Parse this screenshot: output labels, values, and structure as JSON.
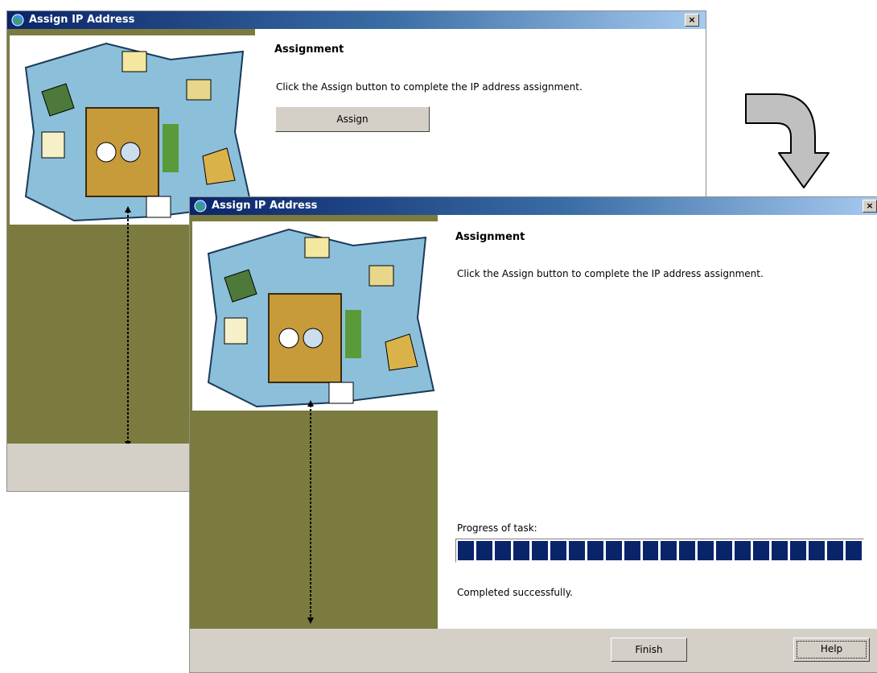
{
  "back_window": {
    "title": "Assign IP Address",
    "heading": "Assignment",
    "description": "Click the Assign button to complete the IP address assignment.",
    "assign_button_label": "Assign",
    "close_label": "×"
  },
  "front_window": {
    "title": "Assign IP Address",
    "heading": "Assignment",
    "description": "Click the Assign button to complete the IP address assignment.",
    "progress_label": "Progress of task:",
    "progress_fraction": 1.0,
    "status_text": "Completed successfully.",
    "finish_button_label": "Finish",
    "help_button_label": "Help",
    "close_label": "×"
  },
  "colors": {
    "titlebar_start": "#0a246a",
    "titlebar_end": "#a6caf0",
    "side_panel": "#7b7b40",
    "progress_fill": "#0a246a",
    "button_face": "#d4d0c8"
  },
  "icons": {
    "app": "globe-network-icon",
    "transition": "curved-arrow-down-icon"
  }
}
